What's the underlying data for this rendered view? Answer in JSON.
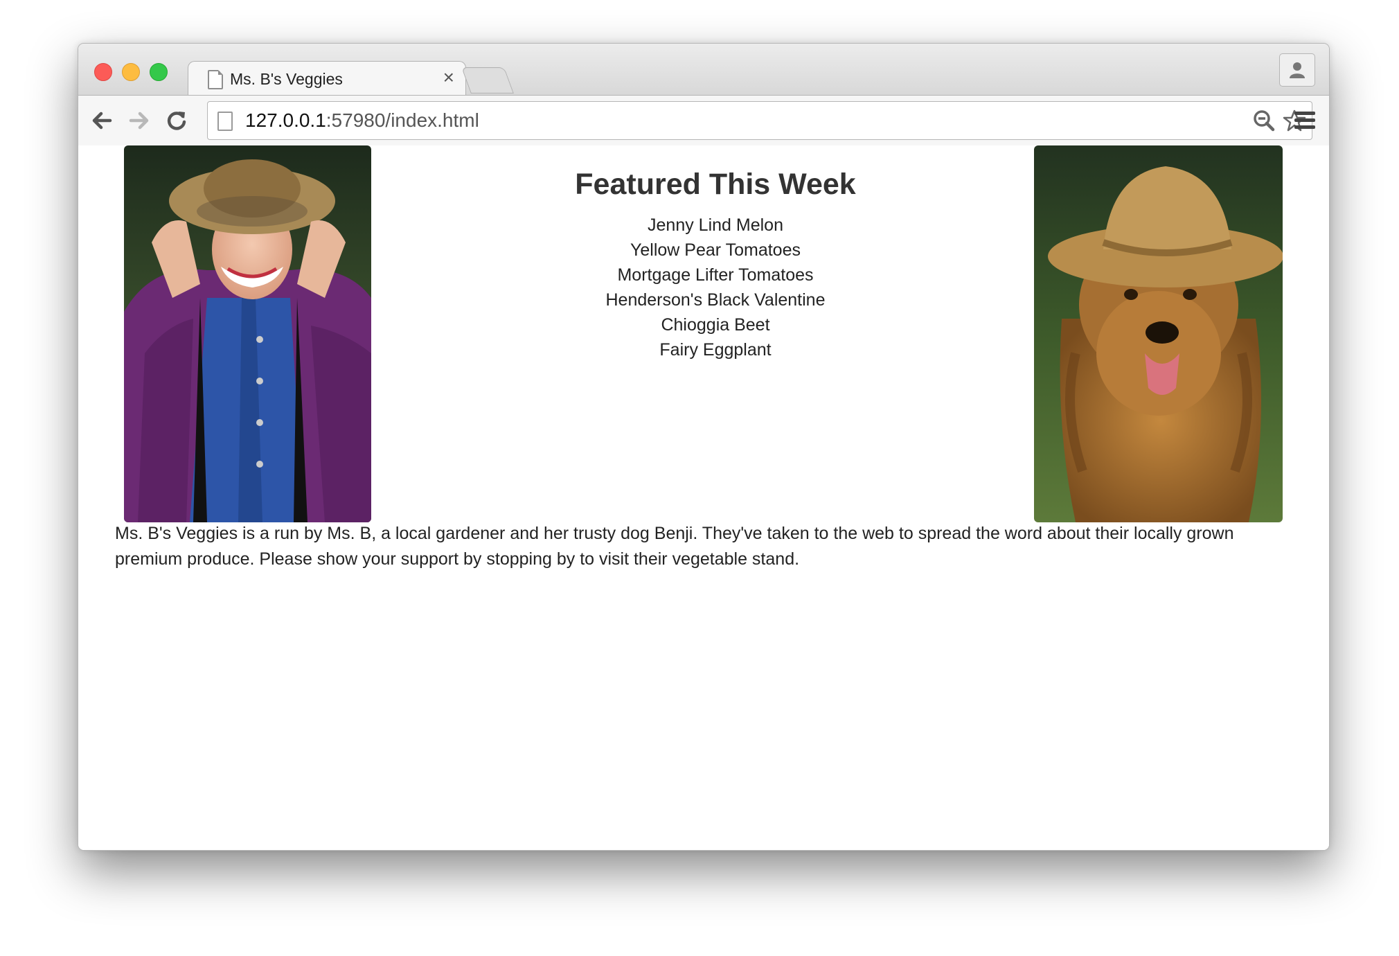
{
  "browser": {
    "tab_title": "Ms. B's Veggies",
    "tab_close": "×",
    "url_host": "127.0.0.1",
    "url_rest": ":57980/index.html",
    "icons": [
      "back-arrow-icon",
      "forward-arrow-icon",
      "reload-icon",
      "page-icon",
      "zoom-icon",
      "bookmark-star-icon",
      "menu-icon",
      "profile-icon"
    ]
  },
  "page": {
    "featured_title": "Featured This Week",
    "featured_items": [
      "Jenny Lind Melon",
      "Yellow Pear Tomatoes",
      "Mortgage Lifter Tomatoes",
      "Henderson's Black Valentine",
      "Chioggia Beet",
      "Fairy Eggplant"
    ],
    "about_text": "Ms. B's Veggies is a run by Ms. B, a local gardener and her trusty dog Benji. They've taken to the web to spread the word about their locally grown premium produce. Please show your support by stopping by to visit their vegetable stand."
  }
}
